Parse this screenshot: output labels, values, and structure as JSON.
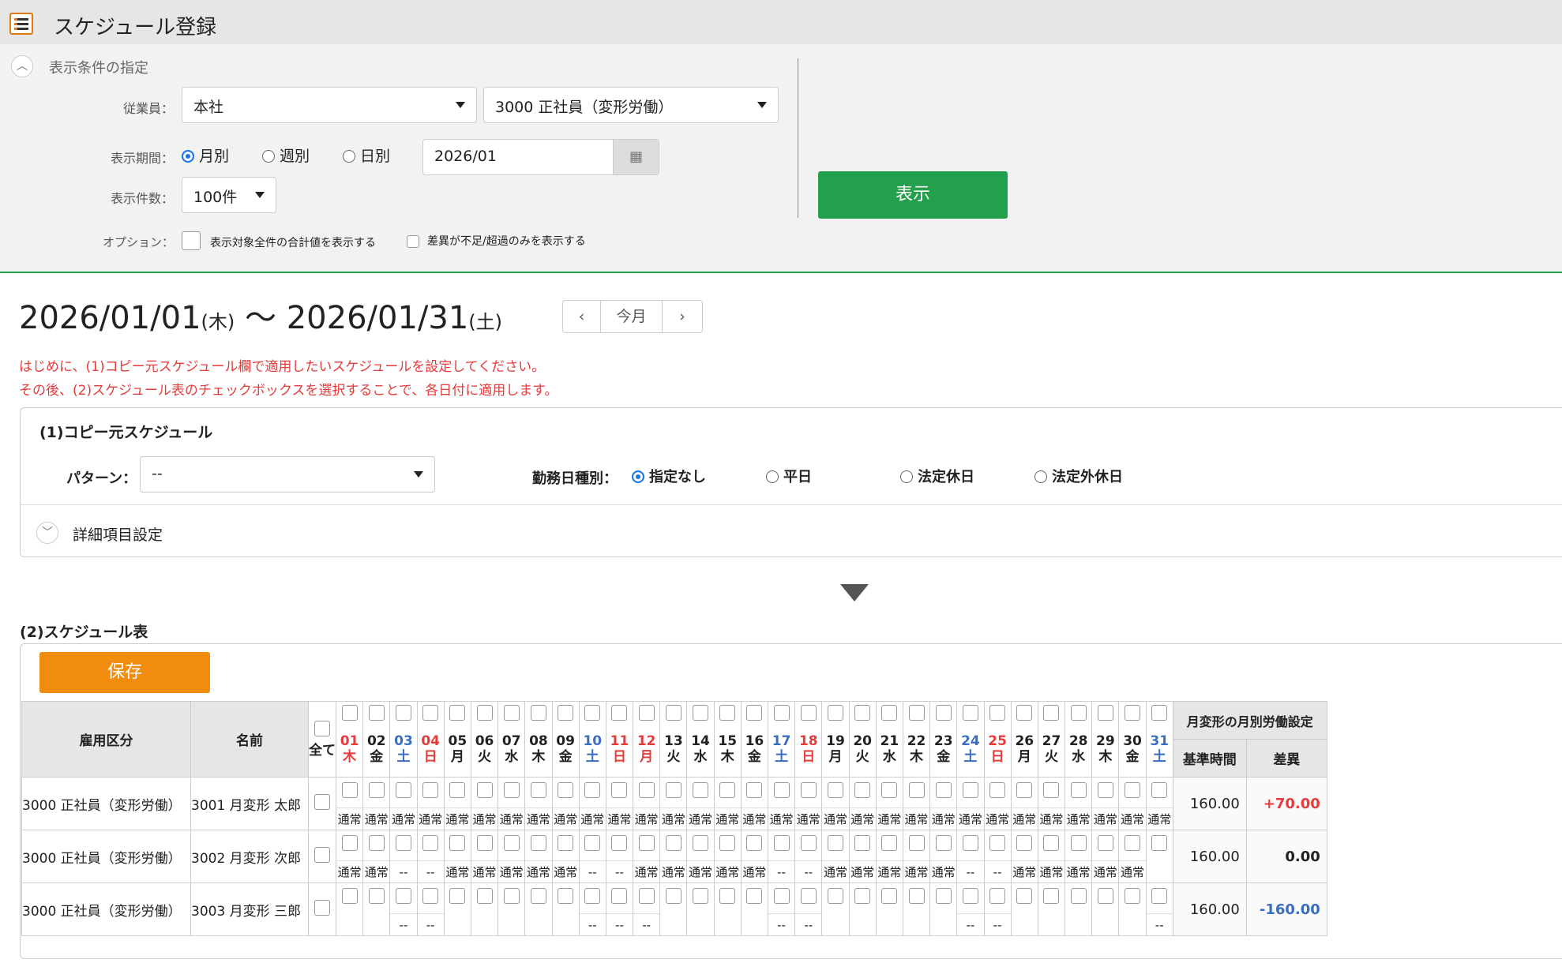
{
  "app": {
    "title": "スケジュール登録"
  },
  "conditions": {
    "section_label": "表示条件の指定",
    "employee_label": "従業員：",
    "branch": "本社",
    "employment": "3000 正社員（変形労働）",
    "period_label": "表示期間：",
    "period_options": [
      "月別",
      "週別",
      "日別"
    ],
    "period_selected": "月別",
    "date_value": "2026/01",
    "count_label": "表示件数：",
    "count_value": "100件",
    "option_label": "オプション：",
    "option1": "表示対象全件の合計値を表示する",
    "option2": "差異が不足/超過のみを表示する",
    "show_button": "表示"
  },
  "range": {
    "start": "2026/01/01",
    "start_dow": "(木)",
    "sep": "〜",
    "end": "2026/01/31",
    "end_dow": "(土)",
    "today_label": "今月"
  },
  "instructions": [
    "はじめに、(1)コピー元スケジュール欄で適用したいスケジュールを設定してください。",
    "その後、(2)スケジュール表のチェックボックスを選択することで、各日付に適用します。"
  ],
  "copy": {
    "title": "(1)コピー元スケジュール",
    "pattern_label": "パターン：",
    "pattern_value": "--",
    "daytype_label": "勤務日種別：",
    "daytype_options": [
      "指定なし",
      "平日",
      "法定休日",
      "法定外休日"
    ],
    "daytype_selected": "指定なし",
    "detail_label": "詳細項目設定"
  },
  "schedule": {
    "title": "(2)スケジュール表",
    "save_button": "保存",
    "col_type": "雇用区分",
    "col_name": "名前",
    "col_all": "全て",
    "col_monthly": "月変形の月別労働設定",
    "col_base": "基準時間",
    "col_diff": "差異",
    "days": [
      {
        "d": "01",
        "w": "木",
        "c": "red"
      },
      {
        "d": "02",
        "w": "金",
        "c": "wk"
      },
      {
        "d": "03",
        "w": "土",
        "c": "sat"
      },
      {
        "d": "04",
        "w": "日",
        "c": "red"
      },
      {
        "d": "05",
        "w": "月",
        "c": "wk"
      },
      {
        "d": "06",
        "w": "火",
        "c": "wk"
      },
      {
        "d": "07",
        "w": "水",
        "c": "wk"
      },
      {
        "d": "08",
        "w": "木",
        "c": "wk"
      },
      {
        "d": "09",
        "w": "金",
        "c": "wk"
      },
      {
        "d": "10",
        "w": "土",
        "c": "sat"
      },
      {
        "d": "11",
        "w": "日",
        "c": "red"
      },
      {
        "d": "12",
        "w": "月",
        "c": "red"
      },
      {
        "d": "13",
        "w": "火",
        "c": "wk"
      },
      {
        "d": "14",
        "w": "水",
        "c": "wk"
      },
      {
        "d": "15",
        "w": "木",
        "c": "wk"
      },
      {
        "d": "16",
        "w": "金",
        "c": "wk"
      },
      {
        "d": "17",
        "w": "土",
        "c": "sat"
      },
      {
        "d": "18",
        "w": "日",
        "c": "red"
      },
      {
        "d": "19",
        "w": "月",
        "c": "wk"
      },
      {
        "d": "20",
        "w": "火",
        "c": "wk"
      },
      {
        "d": "21",
        "w": "水",
        "c": "wk"
      },
      {
        "d": "22",
        "w": "木",
        "c": "wk"
      },
      {
        "d": "23",
        "w": "金",
        "c": "wk"
      },
      {
        "d": "24",
        "w": "土",
        "c": "sat"
      },
      {
        "d": "25",
        "w": "日",
        "c": "red"
      },
      {
        "d": "26",
        "w": "月",
        "c": "wk"
      },
      {
        "d": "27",
        "w": "火",
        "c": "wk"
      },
      {
        "d": "28",
        "w": "水",
        "c": "wk"
      },
      {
        "d": "29",
        "w": "木",
        "c": "wk"
      },
      {
        "d": "30",
        "w": "金",
        "c": "wk"
      },
      {
        "d": "31",
        "w": "土",
        "c": "sat"
      }
    ],
    "rows": [
      {
        "type": "3000 正社員（変形労働）",
        "name": "3001 月変形 太郎",
        "base": "160.00",
        "diff": "+70.00",
        "diff_color": "#e53b3b",
        "cells": [
          "通常",
          "通常",
          "通常",
          "通常",
          "通常",
          "通常",
          "通常",
          "通常",
          "通常",
          "通常",
          "通常",
          "通常",
          "通常",
          "通常",
          "通常",
          "通常",
          "通常",
          "通常",
          "通常",
          "通常",
          "通常",
          "通常",
          "通常",
          "通常",
          "通常",
          "通常",
          "通常",
          "通常",
          "通常",
          "通常",
          "通常"
        ]
      },
      {
        "type": "3000 正社員（変形労働）",
        "name": "3002 月変形 次郎",
        "base": "160.00",
        "diff": "0.00",
        "diff_color": "#222222",
        "cells": [
          "通常",
          "通常",
          "--",
          "--",
          "通常",
          "通常",
          "通常",
          "通常",
          "通常",
          "--",
          "--",
          "通常",
          "通常",
          "通常",
          "通常",
          "通常",
          "--",
          "--",
          "通常",
          "通常",
          "通常",
          "通常",
          "通常",
          "--",
          "--",
          "通常",
          "通常",
          "通常",
          "通常",
          "通常",
          ""
        ]
      },
      {
        "type": "3000 正社員（変形労働）",
        "name": "3003 月変形 三郎",
        "base": "160.00",
        "diff": "-160.00",
        "diff_color": "#3a6ec2",
        "cells": [
          "",
          "",
          "--",
          "--",
          "",
          "",
          "",
          "",
          "",
          "--",
          "--",
          "--",
          "",
          "",
          "",
          "",
          "--",
          "--",
          "",
          "",
          "",
          "",
          "",
          "--",
          "--",
          "",
          "",
          "",
          "",
          "",
          "--"
        ]
      }
    ]
  }
}
